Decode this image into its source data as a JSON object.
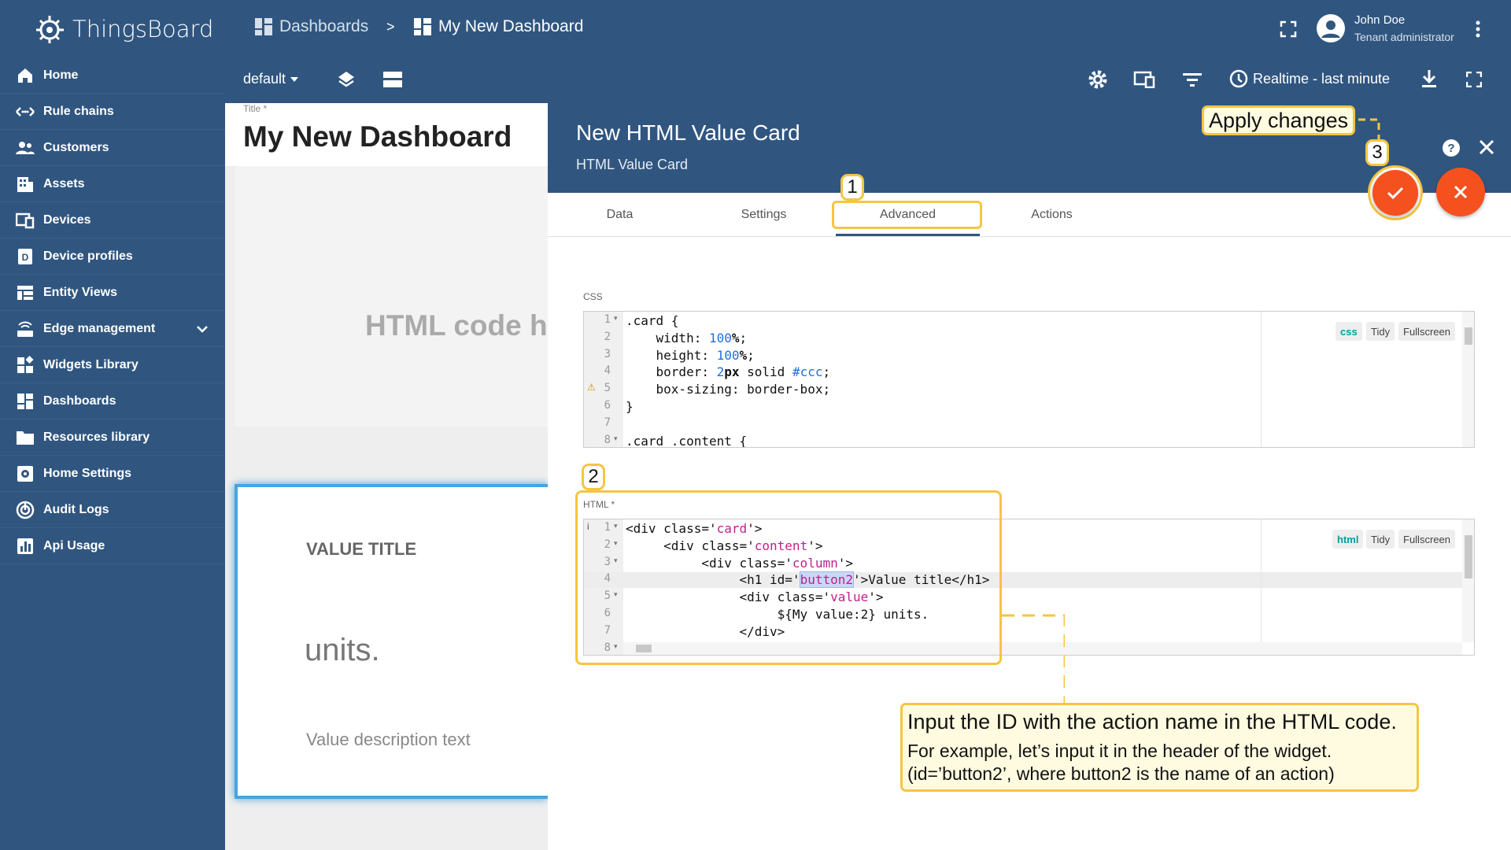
{
  "app": {
    "name": "ThingsBoard"
  },
  "sidebar": {
    "items": [
      {
        "label": "Home",
        "icon": "home-icon"
      },
      {
        "label": "Rule chains",
        "icon": "rule-chain-icon"
      },
      {
        "label": "Customers",
        "icon": "customers-icon"
      },
      {
        "label": "Assets",
        "icon": "assets-icon"
      },
      {
        "label": "Devices",
        "icon": "devices-icon"
      },
      {
        "label": "Device profiles",
        "icon": "device-profile-icon"
      },
      {
        "label": "Entity Views",
        "icon": "entity-views-icon"
      },
      {
        "label": "Edge management",
        "icon": "edge-icon"
      },
      {
        "label": "Widgets Library",
        "icon": "widgets-icon"
      },
      {
        "label": "Dashboards",
        "icon": "dashboards-icon"
      },
      {
        "label": "Resources library",
        "icon": "folder-icon"
      },
      {
        "label": "Home Settings",
        "icon": "home-settings-icon"
      },
      {
        "label": "Audit Logs",
        "icon": "audit-icon"
      },
      {
        "label": "Api Usage",
        "icon": "api-usage-icon"
      }
    ]
  },
  "header": {
    "breadcrumb": [
      "Dashboards",
      ">",
      "My New Dashboard"
    ],
    "user": {
      "name": "John Doe",
      "role": "Tenant administrator"
    },
    "layout_select": "default",
    "timewindow": "Realtime - last minute"
  },
  "dashboard": {
    "title_label": "Title *",
    "title": "My New Dashboard",
    "widget1_text": "HTML code h",
    "card": {
      "title": "VALUE TITLE",
      "value": "units.",
      "description": "Value description text"
    }
  },
  "panel": {
    "title": "New HTML Value Card",
    "subtitle": "HTML Value Card",
    "tabs": [
      "Data",
      "Settings",
      "Advanced",
      "Actions"
    ],
    "active_tab": "Advanced",
    "css_label": "CSS",
    "html_label": "HTML *",
    "editor_buttons": {
      "css": "css",
      "html": "html",
      "tidy": "Tidy",
      "fullscreen": "Fullscreen"
    },
    "css_lines": [
      {
        "n": "1",
        "code": ".card {"
      },
      {
        "n": "2",
        "code": "    width: 100%;"
      },
      {
        "n": "3",
        "code": "    height: 100%;"
      },
      {
        "n": "4",
        "code": "    border: 2px solid #ccc;"
      },
      {
        "n": "5",
        "code": "    box-sizing: border-box;"
      },
      {
        "n": "6",
        "code": "}"
      },
      {
        "n": "7",
        "code": ""
      },
      {
        "n": "8",
        "code": ".card .content {"
      }
    ],
    "html_lines": [
      {
        "n": "1",
        "code": "<div class='card'>"
      },
      {
        "n": "2",
        "code": "     <div class='content'>"
      },
      {
        "n": "3",
        "code": "          <div class='column'>"
      },
      {
        "n": "4",
        "code": "               <h1 id='button2'>Value title</h1>"
      },
      {
        "n": "5",
        "code": "               <div class='value'>"
      },
      {
        "n": "6",
        "code": "                    ${My value:2} units."
      },
      {
        "n": "7",
        "code": "               </div>"
      },
      {
        "n": "8",
        "code": ""
      }
    ]
  },
  "annotations": {
    "badge1": "1",
    "badge2": "2",
    "badge3": "3",
    "apply": "Apply changes",
    "note_title": "Input the ID with the action name in the HTML code.",
    "note_line1": "For example, let’s input it in the header of the widget.",
    "note_line2": "(id=’button2’, where button2 is the name of an action)"
  },
  "colors": {
    "primary": "#305680",
    "accent": "#f4511e",
    "highlight": "#f5c542"
  }
}
